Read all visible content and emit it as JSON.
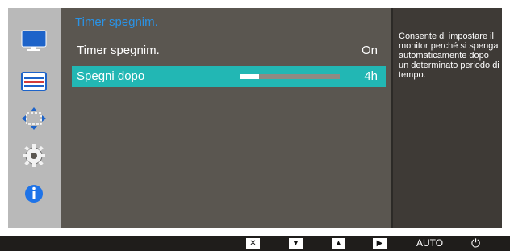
{
  "menu": {
    "title": "Timer spegnim.",
    "rows": [
      {
        "label": "Timer spegnim.",
        "value": "On"
      },
      {
        "label": "Spegni dopo",
        "value": "4h",
        "slider_fraction": 0.19
      }
    ]
  },
  "help_text": "Consente di impostare il monitor perché si spenga automaticamente dopo un determinato periodo di tempo.",
  "sidebar": {
    "items": [
      {
        "icon": "monitor-icon"
      },
      {
        "icon": "settings-bars-icon"
      },
      {
        "icon": "resize-arrows-icon"
      },
      {
        "icon": "gear-icon"
      },
      {
        "icon": "info-icon"
      }
    ]
  },
  "bottom_bar": {
    "auto_label": "AUTO",
    "keys": [
      "close",
      "down",
      "up",
      "enter"
    ]
  },
  "colors": {
    "selected_row": "#22b7b4",
    "title_blue": "#2a93e6"
  }
}
